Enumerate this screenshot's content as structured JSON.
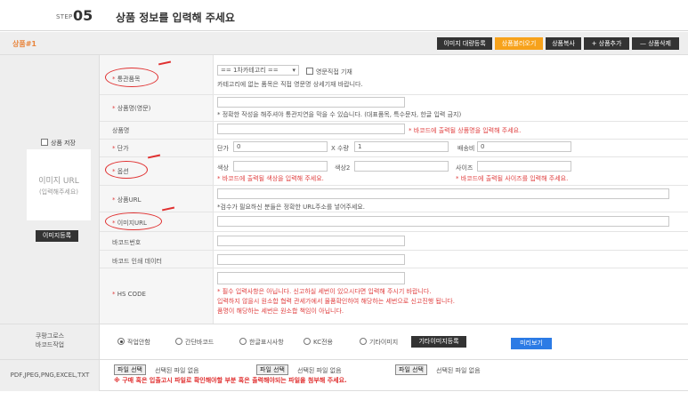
{
  "step": {
    "label": "STEP",
    "number": "05",
    "title": "상품 정보를 입력해 주세요"
  },
  "product": {
    "title": "상품#1"
  },
  "toolbar": {
    "image_bulk": "이미지 대량등록",
    "load_product": "상품불러오기",
    "copy_product": "상품복사",
    "add_product": "+ 상품추가",
    "delete_product": "— 상품삭제"
  },
  "left": {
    "save_label": "상품 저장",
    "image_url": "이미지 URL",
    "image_url_hint": "(입력해주세요)",
    "image_register": "이미지등록"
  },
  "fields": {
    "customs": {
      "label": "통관품목",
      "select_value": "== 1차카테고리 ==",
      "direct_label": "영문직접 기재",
      "note": "카테고리에 없는 품목은 직접 영문명 상세기재 바랍니다."
    },
    "name_en": {
      "label": "상품명(영문)",
      "note": "* 정확한 작성을 해주셔야 통관지연을 막을 수 있습니다. (대표품목, 특수문자, 한글 입력 금지)"
    },
    "name": {
      "label": "상품명",
      "note": "* 바코드에 출력될 상품명을 입력해 주세요."
    },
    "price": {
      "label": "단가",
      "unit_label": "단가",
      "unit_value": "0",
      "qty_label": "X 수량",
      "qty_value": "1",
      "ship_label": "배송비",
      "ship_value": "0"
    },
    "option": {
      "label": "옵션",
      "color_label": "색상",
      "color2_label": "색상2",
      "size_label": "사이즈",
      "color_note": "* 바코드에 출력될 색상을 입력해 주세요.",
      "size_note": "* 바코드에 출력될 사이즈를 입력해 주세요."
    },
    "url": {
      "label": "상품URL",
      "note": "*검수가 필요하신 분들은 정확한 URL주소를 넣어주세요."
    },
    "image_url": {
      "label": "이미지URL"
    },
    "barcode": {
      "label": "바코드번호"
    },
    "barcode_print": {
      "label": "바코드 인쇄 데이터"
    },
    "hscode": {
      "label": "HS CODE",
      "note1": "* 필수 입력사항은 아닙니다. 신고하실 세번이 있으시다면 입력해 주시기 바랍니다.",
      "note2": "입력하지 않을시 원소합 협력 관세가에서 물품확인하여 해당하는 세번으로 신고진행 됩니다.",
      "note3": "품명이 해당하는 세번은 원소합 책임이 아닙니다."
    }
  },
  "coupang": {
    "label1": "쿠팡그로스",
    "label2": "바코드작업",
    "options": [
      "작업안함",
      "간단바코드",
      "한글표시사항",
      "KC전용",
      "기타이미지"
    ],
    "selected": "작업안함",
    "etc_image_button": "기타이미지등록",
    "preview_button": "미리보기"
  },
  "files": {
    "label": "PDF,JPEG,PNG,EXCEL,TXT",
    "choose_label": "파일 선택",
    "none_label": "선택된 파일 없음",
    "warning": "※ 구매 혹은 입출고시 파일로 확인해야할 부분 혹은 출력해야되는 파일을 첨부해 주세요."
  },
  "colors": {
    "accent_orange": "#f7a21b",
    "required_red": "#e04040",
    "preview_blue": "#2c7be5"
  }
}
